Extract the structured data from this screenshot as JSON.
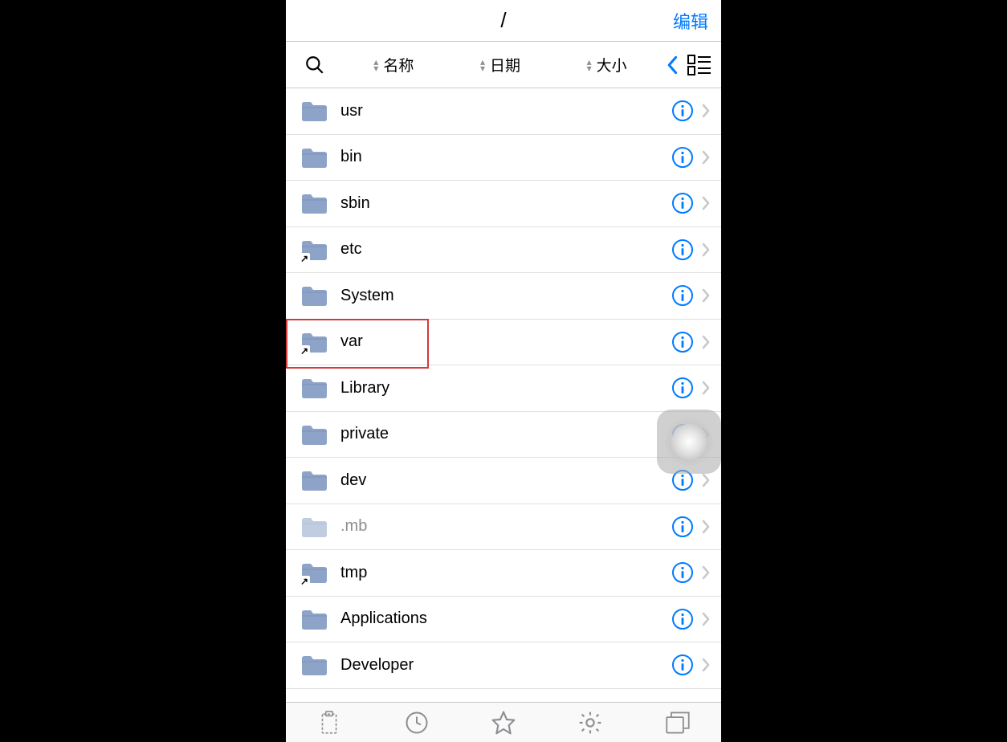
{
  "header": {
    "title": "/",
    "edit_label": "编辑"
  },
  "toolbar": {
    "sort_name": "名称",
    "sort_date": "日期",
    "sort_size": "大小"
  },
  "items": [
    {
      "name": "usr",
      "symlink": false,
      "dimmed": false,
      "highlighted": false
    },
    {
      "name": "bin",
      "symlink": false,
      "dimmed": false,
      "highlighted": false
    },
    {
      "name": "sbin",
      "symlink": false,
      "dimmed": false,
      "highlighted": false
    },
    {
      "name": "etc",
      "symlink": true,
      "dimmed": false,
      "highlighted": false
    },
    {
      "name": "System",
      "symlink": false,
      "dimmed": false,
      "highlighted": false
    },
    {
      "name": "var",
      "symlink": true,
      "dimmed": false,
      "highlighted": true
    },
    {
      "name": "Library",
      "symlink": false,
      "dimmed": false,
      "highlighted": false
    },
    {
      "name": "private",
      "symlink": false,
      "dimmed": false,
      "highlighted": false
    },
    {
      "name": "dev",
      "symlink": false,
      "dimmed": false,
      "highlighted": false
    },
    {
      "name": ".mb",
      "symlink": false,
      "dimmed": true,
      "highlighted": false
    },
    {
      "name": "tmp",
      "symlink": true,
      "dimmed": false,
      "highlighted": false
    },
    {
      "name": "Applications",
      "symlink": false,
      "dimmed": false,
      "highlighted": false
    },
    {
      "name": "Developer",
      "symlink": false,
      "dimmed": false,
      "highlighted": false
    }
  ],
  "tabs": [
    "clipboard",
    "recent",
    "favorites",
    "settings",
    "windows"
  ],
  "colors": {
    "accent": "#007aff",
    "folder": "#8ea3c8"
  }
}
